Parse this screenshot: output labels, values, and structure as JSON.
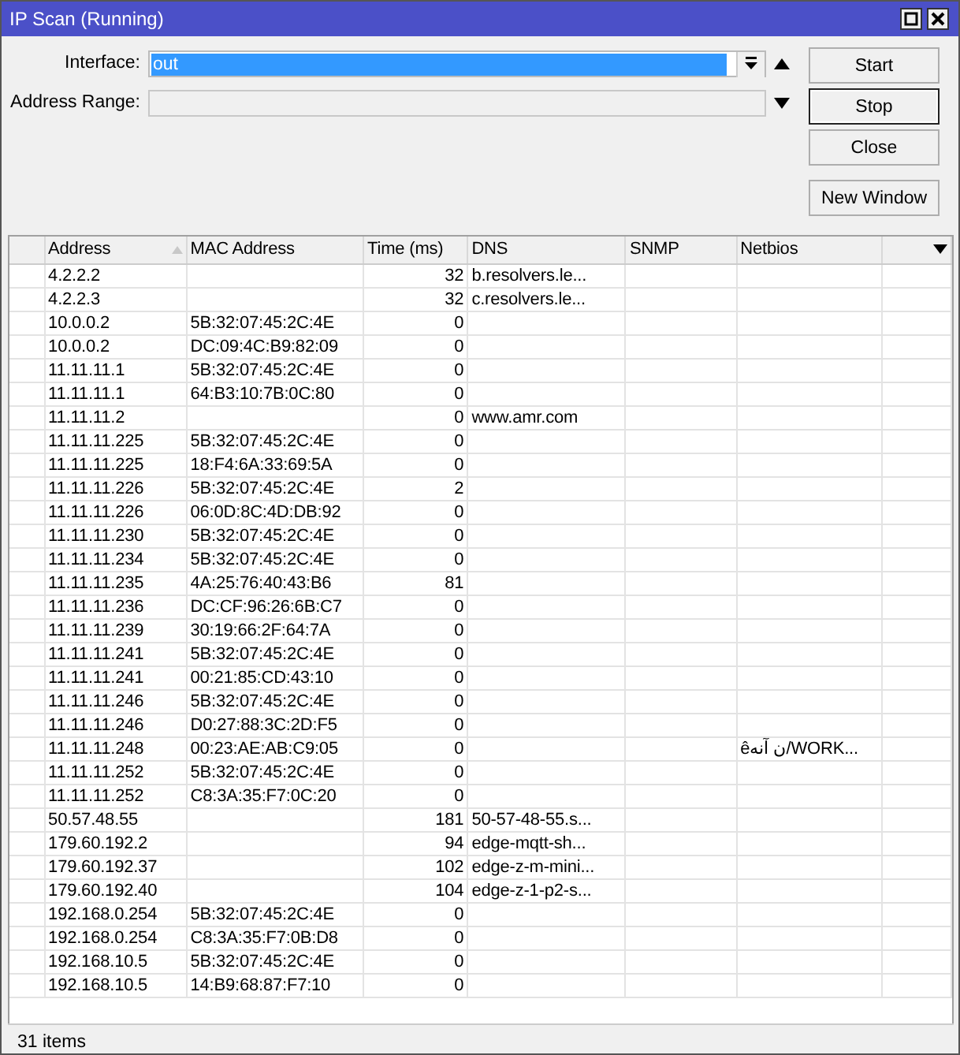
{
  "window": {
    "title": "IP Scan (Running)"
  },
  "form": {
    "interface": {
      "label": "Interface:",
      "value": "out",
      "text_selected": true
    },
    "address_range": {
      "label": "Address Range:"
    },
    "buttons": [
      {
        "label": "Start",
        "focused": false
      },
      {
        "label": "Stop",
        "focused": true
      },
      {
        "label": "Close",
        "focused": false
      },
      {
        "label": "New Window",
        "focused": false
      }
    ]
  },
  "table": {
    "columns": [
      {
        "label": "Address",
        "sorted": true
      },
      {
        "label": "MAC Address",
        "sorted": false
      },
      {
        "label": "Time (ms)",
        "sorted": false
      },
      {
        "label": "DNS",
        "sorted": false
      },
      {
        "label": "SNMP",
        "sorted": false
      },
      {
        "label": "Netbios",
        "sorted": false
      }
    ],
    "rows": [
      {
        "address": "4.2.2.2",
        "time": "32",
        "dns": "b.resolvers.le..."
      },
      {
        "address": "4.2.2.3",
        "time": "32",
        "dns": "c.resolvers.le..."
      },
      {
        "address": "10.0.0.2",
        "mac": "5B:32:07:45:2C:4E",
        "time": "0"
      },
      {
        "address": "10.0.0.2",
        "mac": "DC:09:4C:B9:82:09",
        "time": "0"
      },
      {
        "address": "11.11.11.1",
        "mac": "5B:32:07:45:2C:4E",
        "time": "0"
      },
      {
        "address": "11.11.11.1",
        "mac": "64:B3:10:7B:0C:80",
        "time": "0"
      },
      {
        "address": "11.11.11.2",
        "time": "0",
        "dns": "www.amr.com"
      },
      {
        "address": "11.11.11.225",
        "mac": "5B:32:07:45:2C:4E",
        "time": "0"
      },
      {
        "address": "11.11.11.225",
        "mac": "18:F4:6A:33:69:5A",
        "time": "0"
      },
      {
        "address": "11.11.11.226",
        "mac": "5B:32:07:45:2C:4E",
        "time": "2"
      },
      {
        "address": "11.11.11.226",
        "mac": "06:0D:8C:4D:DB:92",
        "time": "0"
      },
      {
        "address": "11.11.11.230",
        "mac": "5B:32:07:45:2C:4E",
        "time": "0"
      },
      {
        "address": "11.11.11.234",
        "mac": "5B:32:07:45:2C:4E",
        "time": "0"
      },
      {
        "address": "11.11.11.235",
        "mac": "4A:25:76:40:43:B6",
        "time": "81"
      },
      {
        "address": "11.11.11.236",
        "mac": "DC:CF:96:26:6B:C7",
        "time": "0"
      },
      {
        "address": "11.11.11.239",
        "mac": "30:19:66:2F:64:7A",
        "time": "0"
      },
      {
        "address": "11.11.11.241",
        "mac": "5B:32:07:45:2C:4E",
        "time": "0"
      },
      {
        "address": "11.11.11.241",
        "mac": "00:21:85:CD:43:10",
        "time": "0"
      },
      {
        "address": "11.11.11.246",
        "mac": "5B:32:07:45:2C:4E",
        "time": "0"
      },
      {
        "address": "11.11.11.246",
        "mac": "D0:27:88:3C:2D:F5",
        "time": "0"
      },
      {
        "address": "11.11.11.248",
        "mac": "00:23:AE:AB:C9:05",
        "time": "0",
        "netbios": "êن آنه/WORK..."
      },
      {
        "address": "11.11.11.252",
        "mac": "5B:32:07:45:2C:4E",
        "time": "0"
      },
      {
        "address": "11.11.11.252",
        "mac": "C8:3A:35:F7:0C:20",
        "time": "0"
      },
      {
        "address": "50.57.48.55",
        "time": "181",
        "dns": "50-57-48-55.s..."
      },
      {
        "address": "179.60.192.2",
        "time": "94",
        "dns": "edge-mqtt-sh..."
      },
      {
        "address": "179.60.192.37",
        "time": "102",
        "dns": "edge-z-m-mini..."
      },
      {
        "address": "179.60.192.40",
        "time": "104",
        "dns": "edge-z-1-p2-s..."
      },
      {
        "address": "192.168.0.254",
        "mac": "5B:32:07:45:2C:4E",
        "time": "0"
      },
      {
        "address": "192.168.0.254",
        "mac": "C8:3A:35:F7:0B:D8",
        "time": "0"
      },
      {
        "address": "192.168.10.5",
        "mac": "5B:32:07:45:2C:4E",
        "time": "0"
      },
      {
        "address": "192.168.10.5",
        "mac": "14:B9:68:87:F7:10",
        "time": "0"
      }
    ]
  },
  "status_bar": {
    "text": "31 items"
  }
}
